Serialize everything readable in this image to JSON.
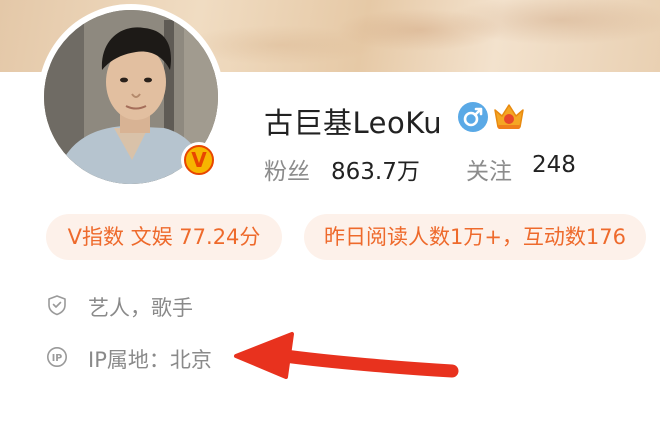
{
  "profile": {
    "name": "古巨基LeoKu",
    "verified_badge": "V",
    "gender_icon": "male-icon",
    "vip_icon": "crown-icon",
    "followers_label": "粉丝",
    "followers_value": "863.7万",
    "following_label": "关注",
    "following_value": "248"
  },
  "chips": {
    "v_index": "V指数 文娱 77.24分",
    "reads": "昨日阅读人数1万+，互动数176"
  },
  "info": {
    "occupation": "艺人，歌手",
    "ip_location": "IP属地：北京"
  },
  "colors": {
    "accent_orange": "#ee6a2c",
    "chip_bg": "#fdf1ea",
    "arrow_red": "#e8321e",
    "gender_blue": "#5aa9e6"
  }
}
